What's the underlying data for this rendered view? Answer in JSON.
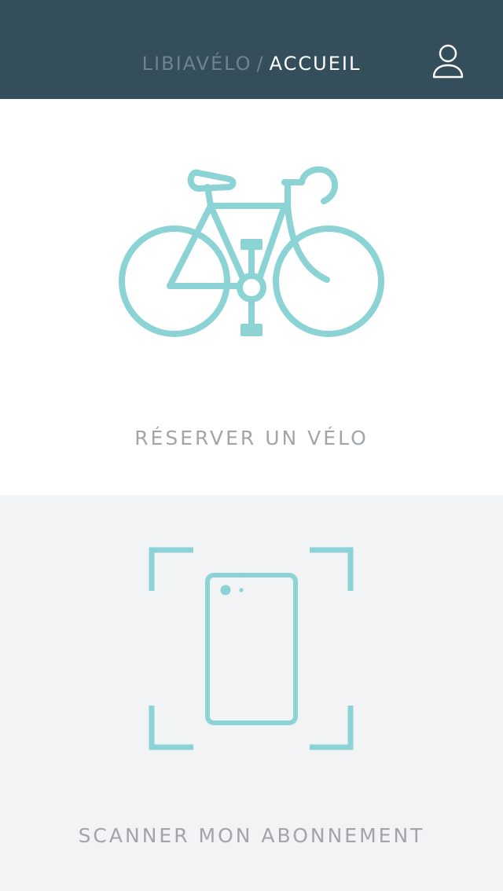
{
  "header": {
    "brand": "LIBIAVÉLO",
    "separator": "/",
    "current_page": "ACCUEIL",
    "profile_icon": "user-icon"
  },
  "actions": {
    "reserve": {
      "icon": "bicycle-icon",
      "label": "RÉSERVER UN VÉLO"
    },
    "scan": {
      "icon": "phone-scan-icon",
      "label": "SCANNER MON ABONNEMENT"
    }
  },
  "colors": {
    "header_bg": "#354e5c",
    "brand_text": "#6f8391",
    "current_text": "#ffffff",
    "accent": "#8cd3d6",
    "label_text": "#a2a5a8",
    "bottom_bg": "#f2f3f5"
  }
}
